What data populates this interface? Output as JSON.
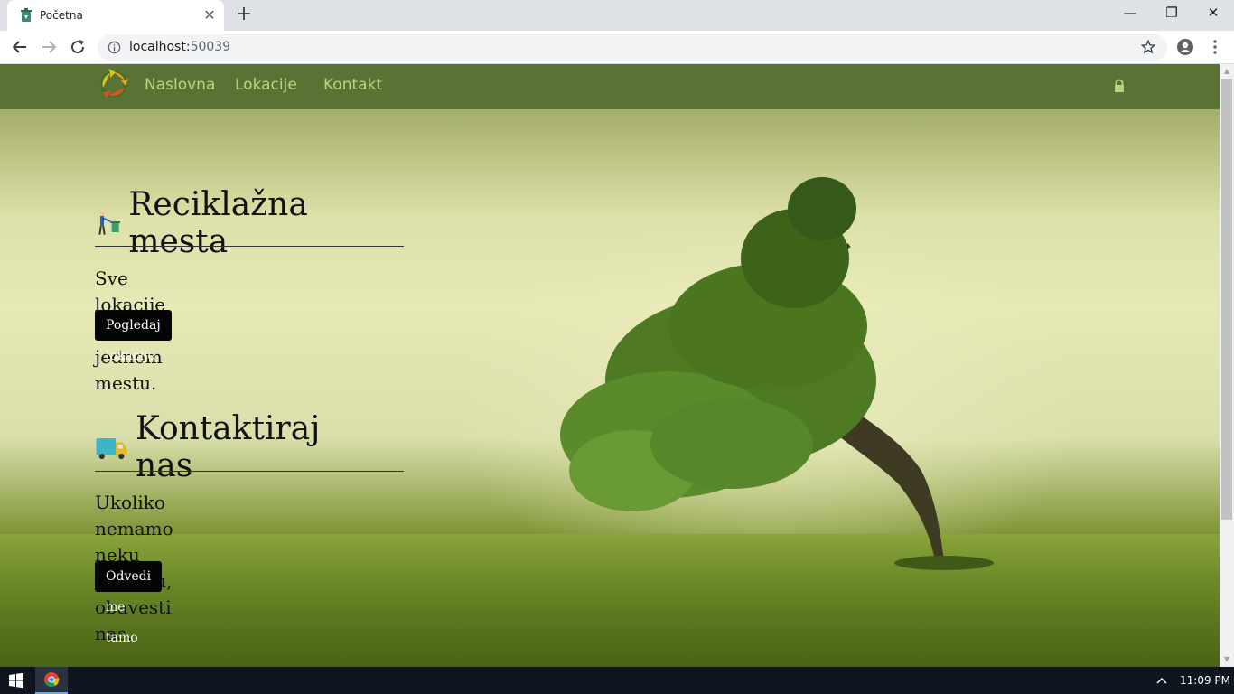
{
  "browser": {
    "tab_title": "Početna",
    "tab_close": "✕",
    "new_tab": "+",
    "url_host": "localhost:",
    "url_port": "50039",
    "window_controls": {
      "minimize": "—",
      "restore": "❐",
      "close": "✕"
    }
  },
  "site": {
    "nav": {
      "links": [
        "Naslovna",
        "Lokacije",
        "Kontakt"
      ]
    },
    "sections": [
      {
        "title": "Reciklažna mesta",
        "text_line1": "Sve lokacije na jednom mestu.",
        "text_line2": "",
        "button": "Pogledaj lokacije"
      },
      {
        "title": "Kontaktiraj nas",
        "text_line1": "Ukoliko nemamo neku lokaciju,",
        "text_line2": "obavesti nas.",
        "button": "Odvedi me tamo"
      }
    ]
  },
  "taskbar": {
    "clock": "11:09 PM"
  },
  "colors": {
    "nav_bg": "#5a7334",
    "nav_link": "#b8d47e",
    "button_bg": "#050505"
  }
}
